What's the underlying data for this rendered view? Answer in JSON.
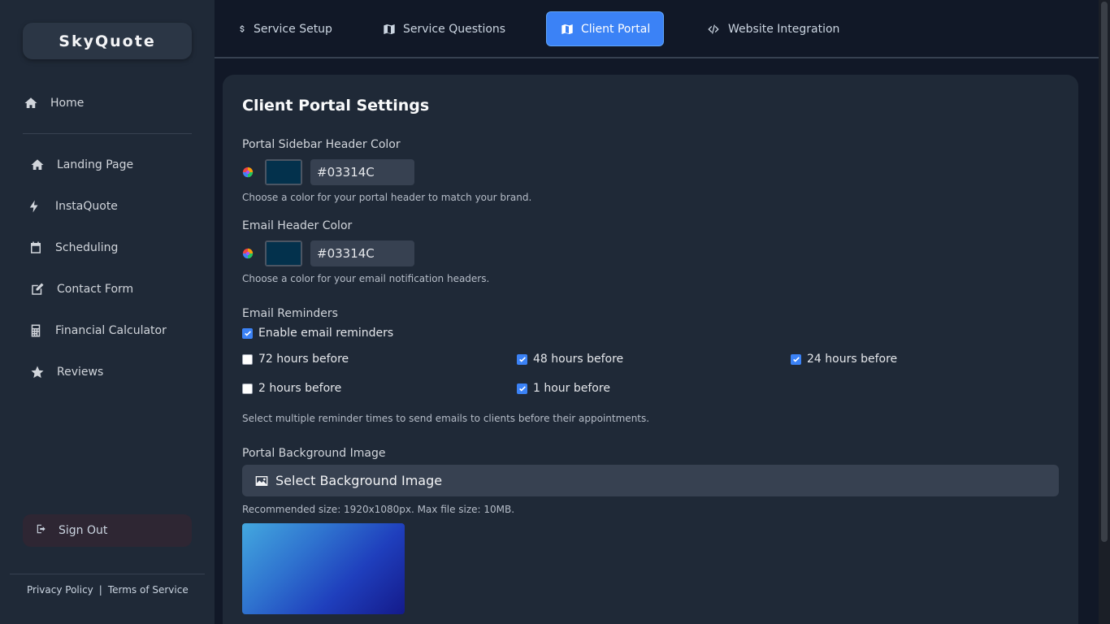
{
  "app": {
    "brand": "SkyQuote"
  },
  "sidebar": {
    "home": "Home",
    "items": [
      {
        "label": "Landing Page",
        "icon": "home-icon"
      },
      {
        "label": "InstaQuote",
        "icon": "bolt-icon"
      },
      {
        "label": "Scheduling",
        "icon": "calendar-icon"
      },
      {
        "label": "Contact Form",
        "icon": "edit-icon"
      },
      {
        "label": "Financial Calculator",
        "icon": "calculator-icon"
      },
      {
        "label": "Reviews",
        "icon": "star-icon"
      }
    ],
    "sign_out": "Sign Out",
    "footer": {
      "privacy": "Privacy Policy",
      "divider": "|",
      "terms": "Terms of Service"
    }
  },
  "tabs": [
    {
      "label": "Service Setup",
      "icon": "dollar-icon",
      "active": false
    },
    {
      "label": "Service Questions",
      "icon": "map-icon",
      "active": false
    },
    {
      "label": "Client Portal",
      "icon": "map-icon",
      "active": true
    },
    {
      "label": "Website Integration",
      "icon": "code-icon",
      "active": false
    }
  ],
  "portal": {
    "title": "Client Portal Settings",
    "sidebar_color": {
      "label": "Portal Sidebar Header Color",
      "value": "#03314C",
      "help": "Choose a color for your portal header to match your brand."
    },
    "email_color": {
      "label": "Email Header Color",
      "value": "#03314C",
      "help": "Choose a color for your email notification headers."
    },
    "reminders": {
      "label": "Email Reminders",
      "enable": {
        "label": "Enable email reminders",
        "checked": true
      },
      "options": [
        {
          "label": "72 hours before",
          "checked": false
        },
        {
          "label": "48 hours before",
          "checked": true
        },
        {
          "label": "24 hours before",
          "checked": true
        },
        {
          "label": "2 hours before",
          "checked": false
        },
        {
          "label": "1 hour before",
          "checked": true
        }
      ],
      "help": "Select multiple reminder times to send emails to clients before their appointments."
    },
    "background": {
      "label": "Portal Background Image",
      "button": "Select Background Image",
      "help": "Recommended size: 1920x1080px. Max file size: 10MB."
    }
  },
  "colors": {
    "accent": "#3b82f6",
    "header_color": "#03314C"
  }
}
